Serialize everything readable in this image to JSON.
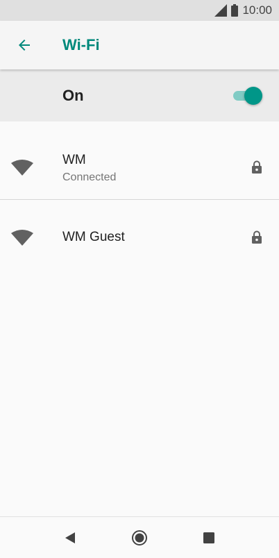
{
  "status_bar": {
    "time": "10:00",
    "icons": [
      "signal-icon",
      "battery-icon"
    ]
  },
  "app_bar": {
    "back_icon": "arrow-back-icon",
    "title": "Wi-Fi"
  },
  "master_switch": {
    "label": "On",
    "state": "on"
  },
  "networks": [
    {
      "name": "WM",
      "status": "Connected",
      "secured": true,
      "icon": "wifi-icon"
    },
    {
      "name": "WM Guest",
      "status": "",
      "secured": true,
      "icon": "wifi-icon"
    }
  ],
  "nav_bar": {
    "buttons": [
      "nav-back-icon",
      "nav-home-icon",
      "nav-recents-icon"
    ]
  },
  "colors": {
    "accent": "#00897b",
    "toggle_thumb": "#009688",
    "toggle_track": "#80cbc4",
    "icon_gray": "#616161"
  }
}
